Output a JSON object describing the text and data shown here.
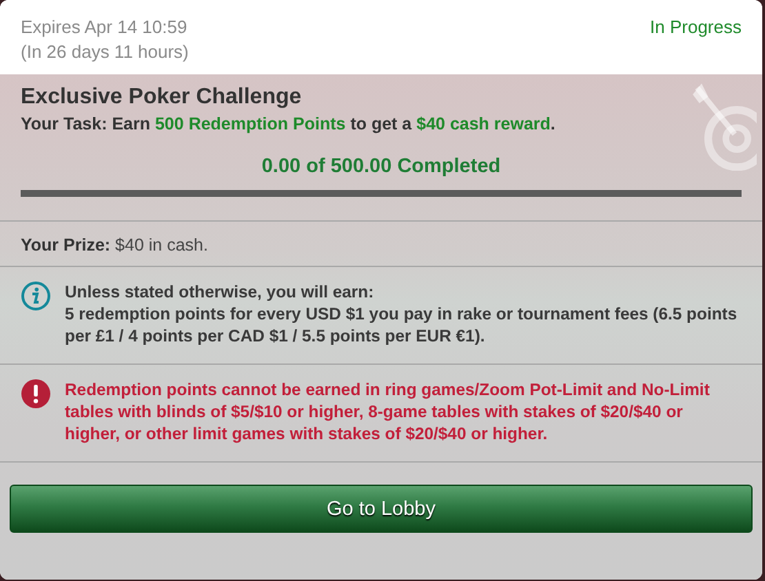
{
  "header": {
    "expires": "Expires Apr 14 10:59",
    "remaining": "(In 26 days 11 hours)",
    "status": "In Progress"
  },
  "challenge": {
    "title": "Exclusive Poker Challenge",
    "task": [
      {
        "text": "Your Task: Earn ",
        "highlight": false
      },
      {
        "text": "500 Redemption Points",
        "highlight": true
      },
      {
        "text": " to get a ",
        "highlight": false
      },
      {
        "text": "$40 cash reward",
        "highlight": true
      },
      {
        "text": ".",
        "highlight": false
      }
    ],
    "progress_text": "0.00 of 500.00 Completed",
    "level": 0
  },
  "prize": "**Your Prize:** $40 in cash.",
  "notices": [
    {
      "kind": "info",
      "lines": [
        "Unless stated otherwise, you will earn:",
        "5 redemption points for every USD $1 you pay in rake or tournament fees (6.5 points per £1 / 4 points per CAD $1 / 5.5 points per EUR €1)."
      ]
    },
    {
      "kind": "warning",
      "lines": [
        "Redemption points cannot be earned in ring games/Zoom Pot-Limit and No-Limit tables with blinds of $5/$10 or higher, 8-game tables with stakes of $20/$40 or higher, or other limit games with stakes of $20/$40 or higher."
      ]
    }
  ],
  "button": "Go to Lobby"
}
